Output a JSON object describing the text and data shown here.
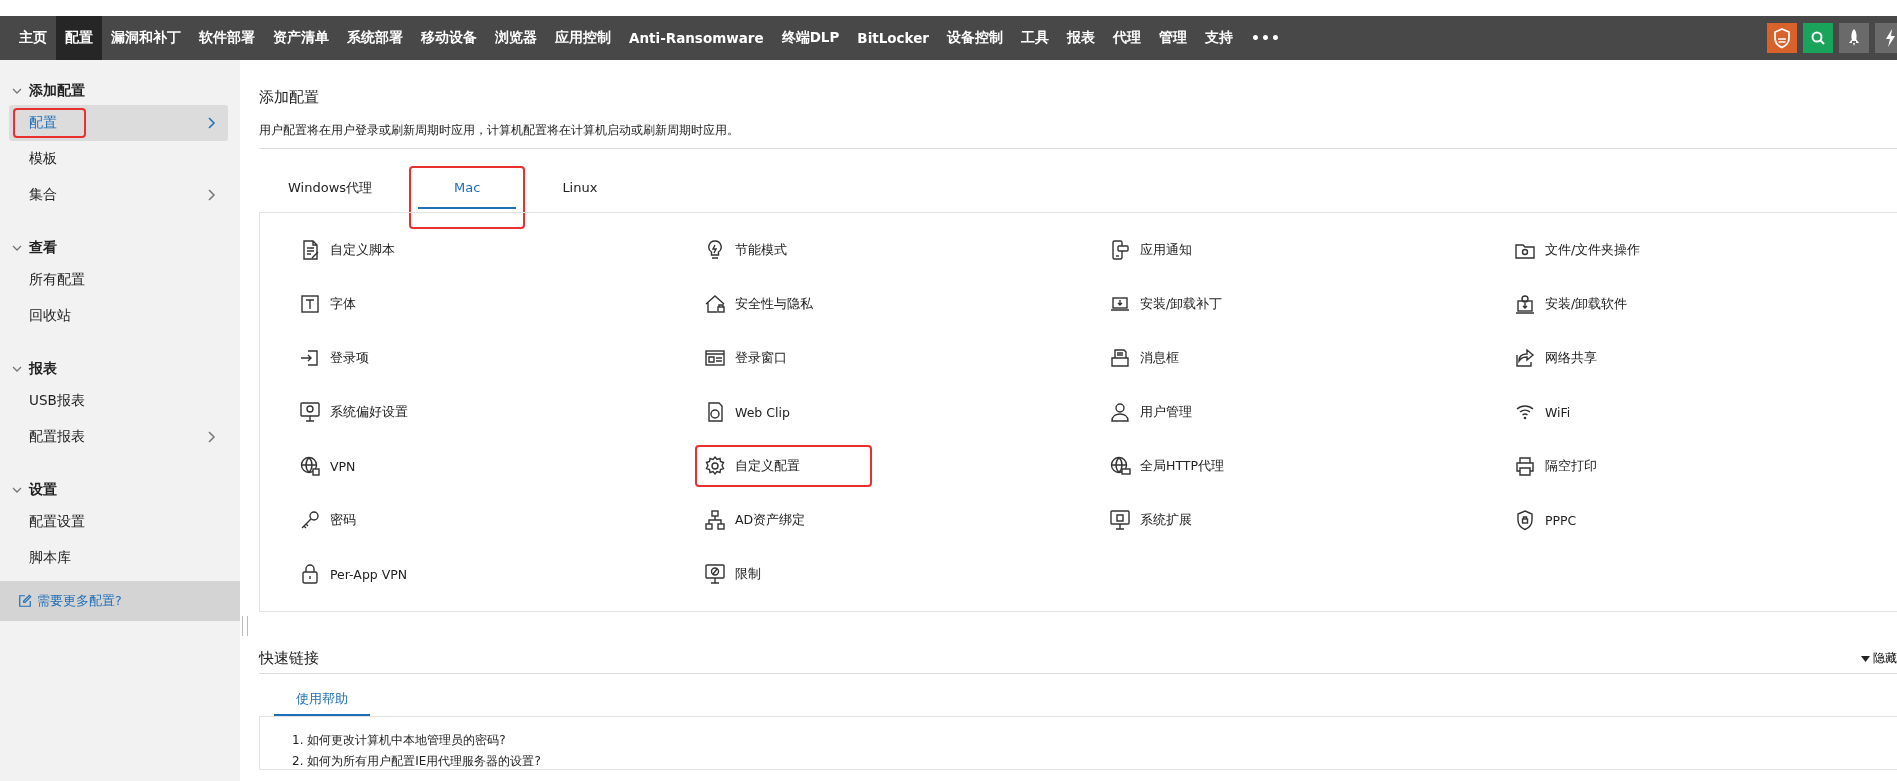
{
  "nav": {
    "items": [
      {
        "label": "主页",
        "selected": false
      },
      {
        "label": "配置",
        "selected": true
      },
      {
        "label": "漏洞和补丁",
        "selected": false
      },
      {
        "label": "软件部署",
        "selected": false
      },
      {
        "label": "资产清单",
        "selected": false
      },
      {
        "label": "系统部署",
        "selected": false
      },
      {
        "label": "移动设备",
        "selected": false
      },
      {
        "label": "浏览器",
        "selected": false
      },
      {
        "label": "应用控制",
        "selected": false
      },
      {
        "label": "Anti-Ransomware",
        "selected": false
      },
      {
        "label": "终端DLP",
        "selected": false
      },
      {
        "label": "BitLocker",
        "selected": false
      },
      {
        "label": "设备控制",
        "selected": false
      },
      {
        "label": "工具",
        "selected": false
      },
      {
        "label": "报表",
        "selected": false
      },
      {
        "label": "代理",
        "selected": false
      },
      {
        "label": "管理",
        "selected": false
      },
      {
        "label": "支持",
        "selected": false
      }
    ],
    "more": "•••"
  },
  "sidebar": {
    "sections": [
      {
        "title": "添加配置",
        "expanded": true,
        "items": [
          {
            "label": "配置",
            "selected": true,
            "has_submenu": true,
            "highlighted": true
          },
          {
            "label": "模板",
            "selected": false,
            "has_submenu": false,
            "highlighted": false
          },
          {
            "label": "集合",
            "selected": false,
            "has_submenu": true,
            "highlighted": false
          }
        ]
      },
      {
        "title": "查看",
        "expanded": true,
        "items": [
          {
            "label": "所有配置",
            "selected": false,
            "has_submenu": false,
            "highlighted": false
          },
          {
            "label": "回收站",
            "selected": false,
            "has_submenu": false,
            "highlighted": false
          }
        ]
      },
      {
        "title": "报表",
        "expanded": true,
        "items": [
          {
            "label": "USB报表",
            "selected": false,
            "has_submenu": false,
            "highlighted": false
          },
          {
            "label": "配置报表",
            "selected": false,
            "has_submenu": true,
            "highlighted": false
          }
        ]
      },
      {
        "title": "设置",
        "expanded": true,
        "items": [
          {
            "label": "配置设置",
            "selected": false,
            "has_submenu": false,
            "highlighted": false
          },
          {
            "label": "脚本库",
            "selected": false,
            "has_submenu": false,
            "highlighted": false
          }
        ]
      }
    ],
    "footer_link": "需要更多配置?"
  },
  "page": {
    "title": "添加配置",
    "description": "用户配置将在用户登录或刷新周期时应用，计算机配置将在计算机启动或刷新周期时应用。",
    "tabs": [
      {
        "label": "Windows代理",
        "selected": false,
        "highlighted": false
      },
      {
        "label": "Mac",
        "selected": true,
        "highlighted": true
      },
      {
        "label": "Linux",
        "selected": false,
        "highlighted": false
      }
    ],
    "config_items": [
      {
        "label": "自定义脚本",
        "highlighted": false
      },
      {
        "label": "节能模式",
        "highlighted": false
      },
      {
        "label": "应用通知",
        "highlighted": false
      },
      {
        "label": "文件/文件夹操作",
        "highlighted": false
      },
      {
        "label": "字体",
        "highlighted": false
      },
      {
        "label": "安全性与隐私",
        "highlighted": false
      },
      {
        "label": "安装/卸载补丁",
        "highlighted": false
      },
      {
        "label": "安装/卸载软件",
        "highlighted": false
      },
      {
        "label": "登录项",
        "highlighted": false
      },
      {
        "label": "登录窗口",
        "highlighted": false
      },
      {
        "label": "消息框",
        "highlighted": false
      },
      {
        "label": "网络共享",
        "highlighted": false
      },
      {
        "label": "系统偏好设置",
        "highlighted": false
      },
      {
        "label": "Web Clip",
        "highlighted": false
      },
      {
        "label": "用户管理",
        "highlighted": false
      },
      {
        "label": "WiFi",
        "highlighted": false
      },
      {
        "label": "VPN",
        "highlighted": false
      },
      {
        "label": "自定义配置",
        "highlighted": true
      },
      {
        "label": "全局HTTP代理",
        "highlighted": false
      },
      {
        "label": "隔空打印",
        "highlighted": false
      },
      {
        "label": "密码",
        "highlighted": false
      },
      {
        "label": "AD资产绑定",
        "highlighted": false
      },
      {
        "label": "系统扩展",
        "highlighted": false
      },
      {
        "label": "PPPC",
        "highlighted": false
      },
      {
        "label": "Per-App VPN",
        "highlighted": false
      },
      {
        "label": "限制",
        "highlighted": false
      }
    ]
  },
  "quick_links": {
    "title": "快速链接",
    "toggle": "隐藏",
    "expanded": true,
    "tabs": [
      {
        "label": "使用帮助",
        "selected": true
      }
    ],
    "items": [
      "1. 如何更改计算机中本地管理员的密码?",
      "2. 如何为所有用户配置IE用代理服务器的设置?"
    ]
  }
}
